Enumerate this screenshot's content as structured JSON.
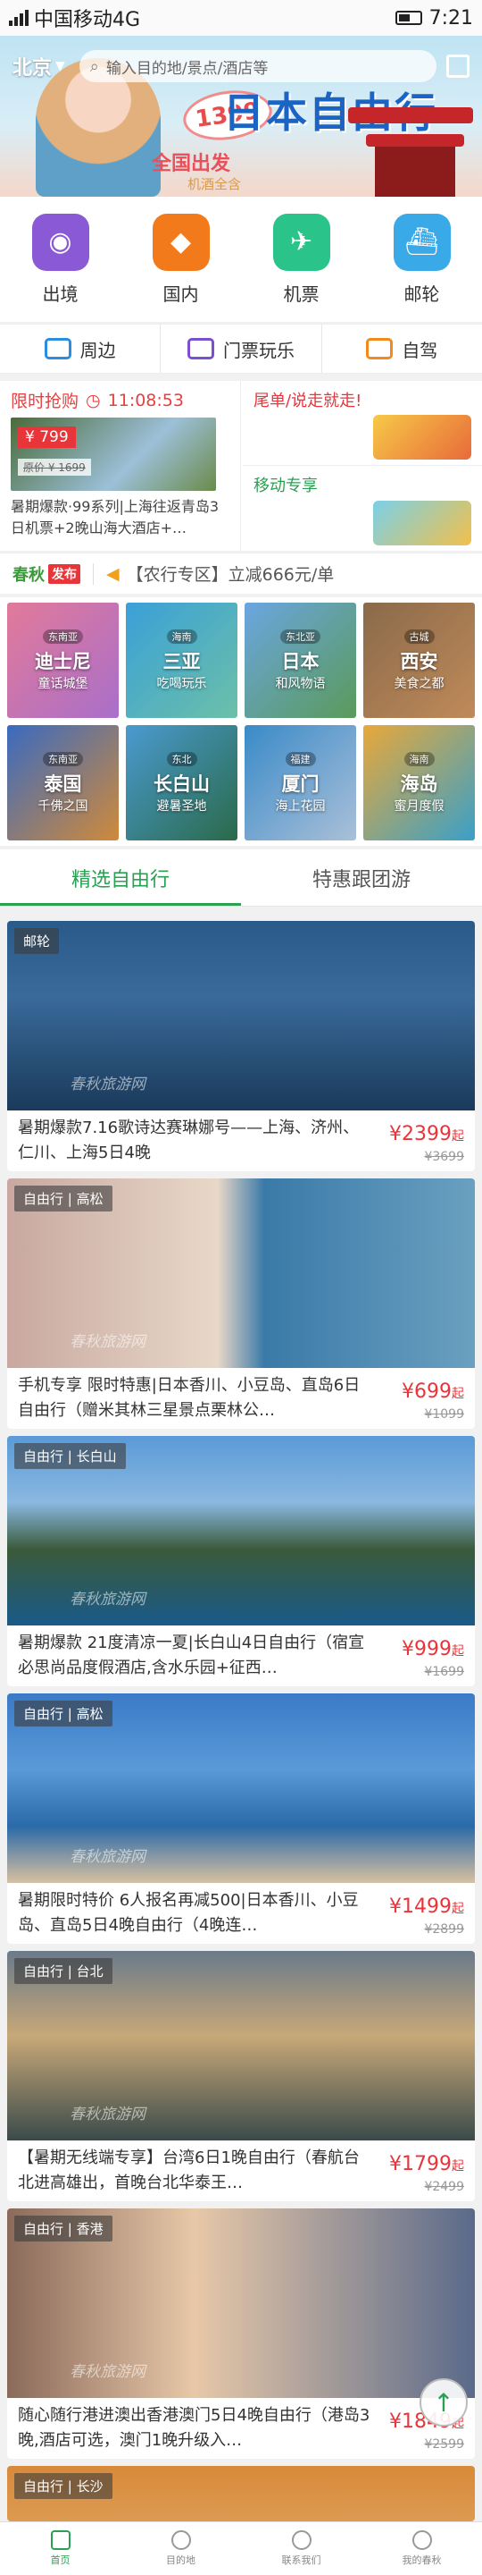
{
  "status_bar": {
    "carrier": "中国移动4G",
    "time": "7:21"
  },
  "header": {
    "city": "北京",
    "search_placeholder": "输入目的地/景点/酒店等"
  },
  "banner": {
    "price": "1399",
    "headline": "日本自由行",
    "subline": "全国出发",
    "tagline": "机酒全含"
  },
  "categories": [
    {
      "label": "出境",
      "icon": "globe-icon",
      "color": "#8a5ad6"
    },
    {
      "label": "国内",
      "icon": "china-map-icon",
      "color": "#f27a1a"
    },
    {
      "label": "机票",
      "icon": "plane-icon",
      "color": "#2ac48a"
    },
    {
      "label": "邮轮",
      "icon": "cruise-ship-icon",
      "color": "#3aa9e8"
    }
  ],
  "subnav": [
    {
      "label": "周边",
      "icon": "car-icon"
    },
    {
      "label": "门票玩乐",
      "icon": "ticket-icon"
    },
    {
      "label": "自驾",
      "icon": "self-drive-icon"
    }
  ],
  "flash_sale": {
    "title": "限时抢购",
    "timer": "11:08:53",
    "price": "¥ 799",
    "original": "原价 ¥ 1699",
    "desc": "暑期爆款·99系列|上海往返青岛3日机票+2晚山海大酒店+…"
  },
  "side_promos": [
    {
      "label": "尾单/说走就走!",
      "color": "#e8353a"
    },
    {
      "label": "移动专享",
      "color": "#2aa052"
    }
  ],
  "notice": {
    "brand": "春秋",
    "brand_tag": "发布",
    "text": "【农行专区】立减666元/单"
  },
  "destinations": [
    {
      "tag": "东南亚",
      "name": "迪士尼",
      "sub": "童话城堡",
      "bg": "linear-gradient(135deg,#e27a9a,#a96fc9)"
    },
    {
      "tag": "海南",
      "name": "三亚",
      "sub": "吃喝玩乐",
      "bg": "linear-gradient(135deg,#3aa0d8,#6cc0a8)"
    },
    {
      "tag": "东北亚",
      "name": "日本",
      "sub": "和风物语",
      "bg": "linear-gradient(135deg,#6aa6e0,#5a9a5a)"
    },
    {
      "tag": "古城",
      "name": "西安",
      "sub": "美食之都",
      "bg": "linear-gradient(135deg,#8a6a4a,#c08a5a)"
    },
    {
      "tag": "东南亚",
      "name": "泰国",
      "sub": "千佛之国",
      "bg": "linear-gradient(135deg,#3a6ac0,#d08a3a)"
    },
    {
      "tag": "东北",
      "name": "长白山",
      "sub": "避暑圣地",
      "bg": "linear-gradient(135deg,#4a9ad0,#2a6a4a)"
    },
    {
      "tag": "福建",
      "name": "厦门",
      "sub": "海上花园",
      "bg": "linear-gradient(135deg,#3a8ac8,#aac0d8)"
    },
    {
      "tag": "海南",
      "name": "海岛",
      "sub": "蜜月度假",
      "bg": "linear-gradient(135deg,#e8a83a,#3aa0c8)"
    }
  ],
  "tabs": [
    {
      "label": "精选自由行"
    },
    {
      "label": "特惠跟团游"
    }
  ],
  "watermark": "春秋旅游网",
  "products": [
    {
      "badge": "邮轮",
      "title": "暑期爆款7.16歌诗达赛琳娜号——上海、济州、仁川、上海5日4晚",
      "price": "¥2399",
      "orig": "¥3699",
      "bg": "linear-gradient(180deg,#2a5a8a 0%,#3a6a9a 40%,#1a3a5a 100%)"
    },
    {
      "badge": "自由行 | 高松",
      "title": "手机专享 限时特惠|日本香川、小豆岛、直岛6日自由行（赠米其林三星景点栗林公…",
      "price": "¥699",
      "orig": "¥1099",
      "bg": "linear-gradient(90deg,#c8a8a0 0%,#e8d8c8 45%,#3a7aa8 55%,#6aa0c0 100%)"
    },
    {
      "badge": "自由行 | 长白山",
      "title": "暑期爆款 21度清凉一夏|长白山4日自由行（宿宣必思尚品度假酒店,含水乐园+征西…",
      "price": "¥999",
      "orig": "¥1699",
      "bg": "linear-gradient(180deg,#5a9ad8 0%,#8ab8e0 35%,#3a5a3a 60%,#1a5a8a 100%)"
    },
    {
      "badge": "自由行 | 高松",
      "title": "暑期限时特价 6人报名再减500|日本香川、小豆岛、直岛5日4晚自由行（4晚连…",
      "price": "¥1499",
      "orig": "¥2899",
      "bg": "linear-gradient(180deg,#3a7ac8 0%,#5a9ad8 40%,#2a6aa8 70%,#d8c0a0 100%)"
    },
    {
      "badge": "自由行 | 台北",
      "title": "【暑期无线端专享】台湾6日1晚自由行（春航台北进高雄出，首晚台北华泰王…",
      "price": "¥1799",
      "orig": "¥2499",
      "bg": "linear-gradient(180deg,#6a7a8a 0%,#c8a878 45%,#3a4a4a 100%)"
    },
    {
      "badge": "自由行 | 香港",
      "title": "随心随行港进澳出香港澳门5日4晚自由行（港岛3晚,酒店可选，澳门1晚升级入…",
      "price": "¥1849",
      "orig": "¥2599",
      "bg": "linear-gradient(90deg,#8a6a5a 0%,#e8c8a8 40%,#5a6a8a 100%)"
    },
    {
      "badge": "自由行 | 长沙",
      "title": "",
      "price": "",
      "orig": "",
      "bg": "linear-gradient(180deg,#d88a3a 0%,#e8c08a 100%)"
    }
  ],
  "footer": [
    {
      "label": "首页"
    },
    {
      "label": "目的地"
    },
    {
      "label": "联系我们"
    },
    {
      "label": "我的春秋"
    }
  ]
}
